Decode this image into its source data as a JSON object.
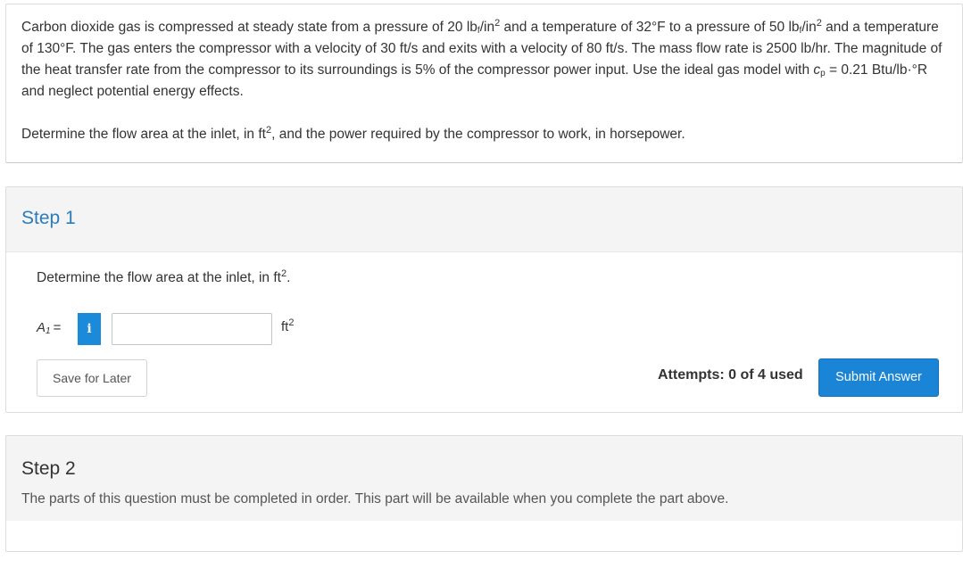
{
  "question": {
    "paragraph1": {
      "t1": "Carbon dioxide gas is compressed at steady state from a pressure of 20 lb",
      "t2": "/in",
      "t3": " and a temperature of 32°F to a pressure of 50 lb",
      "t4": "/in",
      "t5": " and a temperature of 130°F. The gas enters the compressor with a velocity of 30 ft/s and exits with a velocity of 80 ft/s. The mass flow rate is 2500 lb/hr. The magnitude of the heat transfer rate from the compressor to its surroundings is 5% of the compressor power input. Use the ideal gas model with ",
      "cp_c": "c",
      "cp_sub": "p",
      "t6": " = 0.21 Btu/lb·°R and neglect potential energy effects.",
      "sub_f": "f",
      "sup_2": "2"
    },
    "paragraph2": {
      "t1": "Determine the flow area at the inlet, in ft",
      "sup": "2",
      "t2": ", and the power required by the compressor to work, in horsepower."
    }
  },
  "step1": {
    "title": "Step 1",
    "prompt_text": "Determine the flow area at the inlet, in ft",
    "prompt_sup": "2",
    "prompt_end": ".",
    "variable": "A",
    "variable_sub": "1",
    "equals": "=",
    "info_icon": "i",
    "input_value": "",
    "unit": "ft",
    "unit_sup": "2",
    "save_label": "Save for Later",
    "attempts": "Attempts: 0 of 4 used",
    "submit_label": "Submit Answer"
  },
  "step2": {
    "title": "Step 2",
    "text": "The parts of this question must be completed in order. This part will be available when you complete the part above."
  },
  "colors": {
    "accent": "#2b7bbd",
    "button": "#1a85d6",
    "panel": "#f4f4f4"
  }
}
